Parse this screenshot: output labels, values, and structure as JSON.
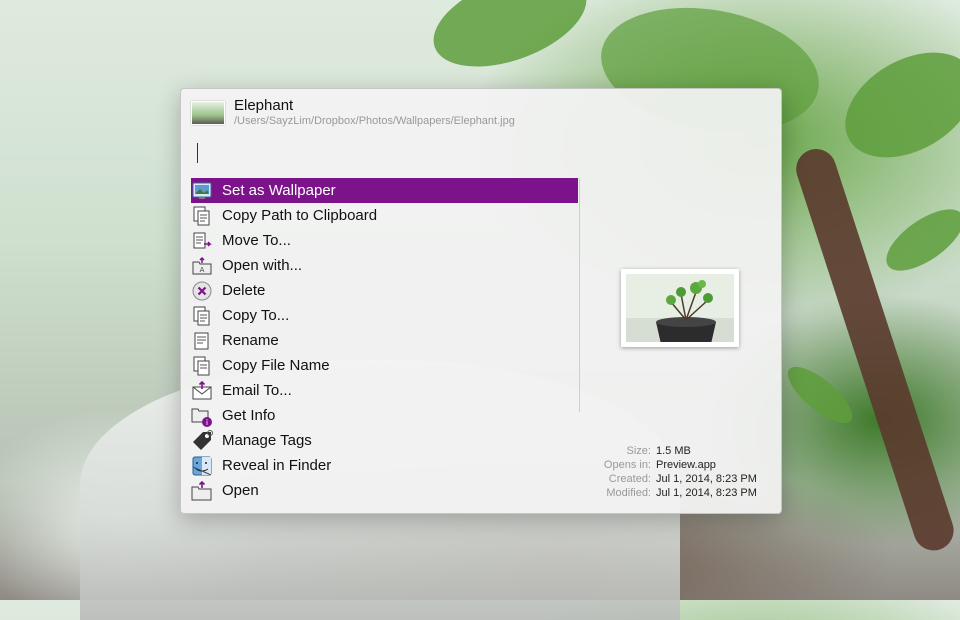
{
  "header": {
    "title": "Elephant",
    "path": "/Users/SayzLim/Dropbox/Photos/Wallpapers/Elephant.jpg"
  },
  "search": {
    "value": ""
  },
  "actions": [
    {
      "label": "Set as Wallpaper",
      "icon": "wallpaper-icon",
      "selected": true
    },
    {
      "label": "Copy Path to Clipboard",
      "icon": "copy-path-icon",
      "selected": false
    },
    {
      "label": "Move To...",
      "icon": "move-file-icon",
      "selected": false
    },
    {
      "label": "Open with...",
      "icon": "open-with-icon",
      "selected": false
    },
    {
      "label": "Delete",
      "icon": "delete-icon",
      "selected": false
    },
    {
      "label": "Copy To...",
      "icon": "copy-file-icon",
      "selected": false
    },
    {
      "label": "Rename",
      "icon": "rename-icon",
      "selected": false
    },
    {
      "label": "Copy File Name",
      "icon": "copy-name-icon",
      "selected": false
    },
    {
      "label": "Email To...",
      "icon": "email-icon",
      "selected": false
    },
    {
      "label": "Get Info",
      "icon": "info-icon",
      "selected": false
    },
    {
      "label": "Manage Tags",
      "icon": "tag-icon",
      "selected": false
    },
    {
      "label": "Reveal in Finder",
      "icon": "finder-icon",
      "selected": false
    },
    {
      "label": "Open",
      "icon": "open-folder-icon",
      "selected": false
    }
  ],
  "meta": {
    "size_label": "Size:",
    "size": "1.5 MB",
    "opens_label": "Opens in:",
    "opens": "Preview.app",
    "created_label": "Created:",
    "created": "Jul 1, 2014, 8:23 PM",
    "modified_label": "Modified:",
    "modified": "Jul 1, 2014, 8:23 PM"
  },
  "colors": {
    "selection": "#7c138a"
  }
}
